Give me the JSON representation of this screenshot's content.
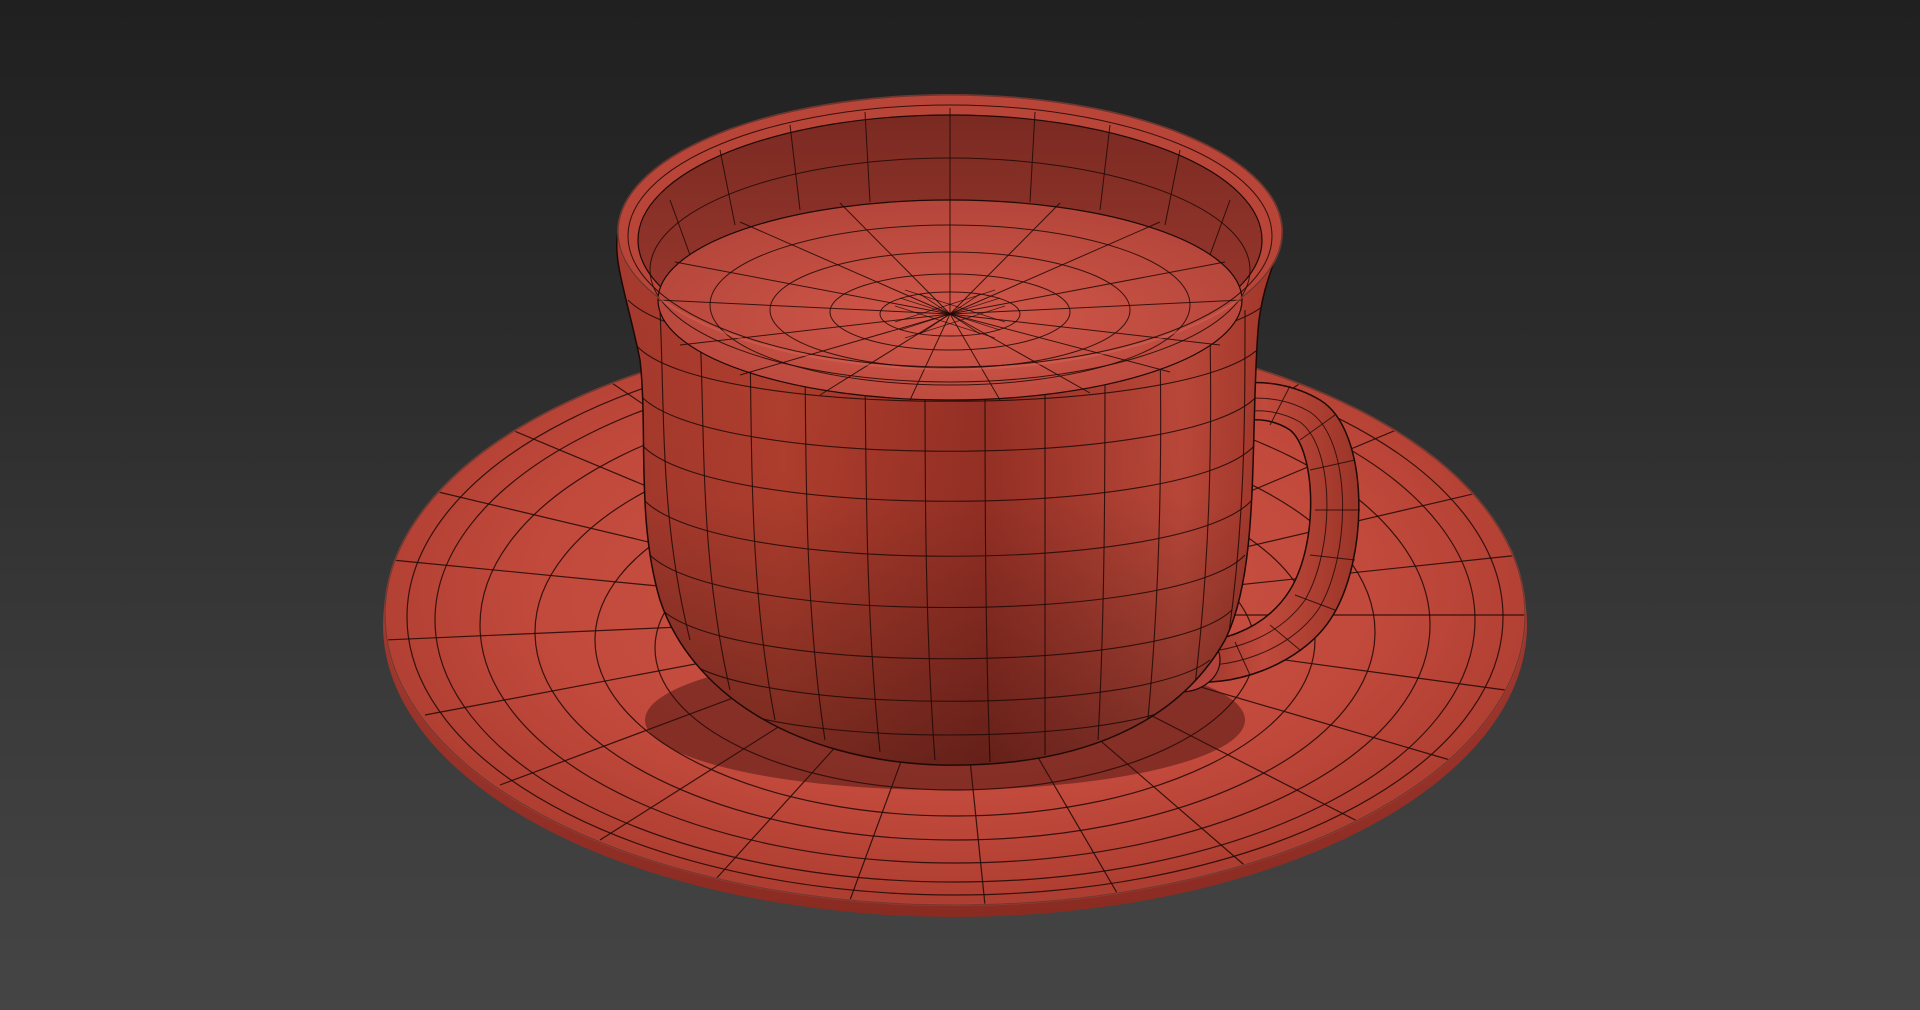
{
  "scene": {
    "subject_icon": "teacup-wireframe-icon",
    "colors": {
      "background_top": "#202020",
      "background_bottom": "#454545",
      "mesh_fill": "#c24a3c",
      "mesh_fill_light": "#d25a49",
      "mesh_fill_dark": "#6e1f18",
      "wire": "#1e0806"
    },
    "objects": [
      "saucer",
      "cup",
      "handle"
    ]
  }
}
